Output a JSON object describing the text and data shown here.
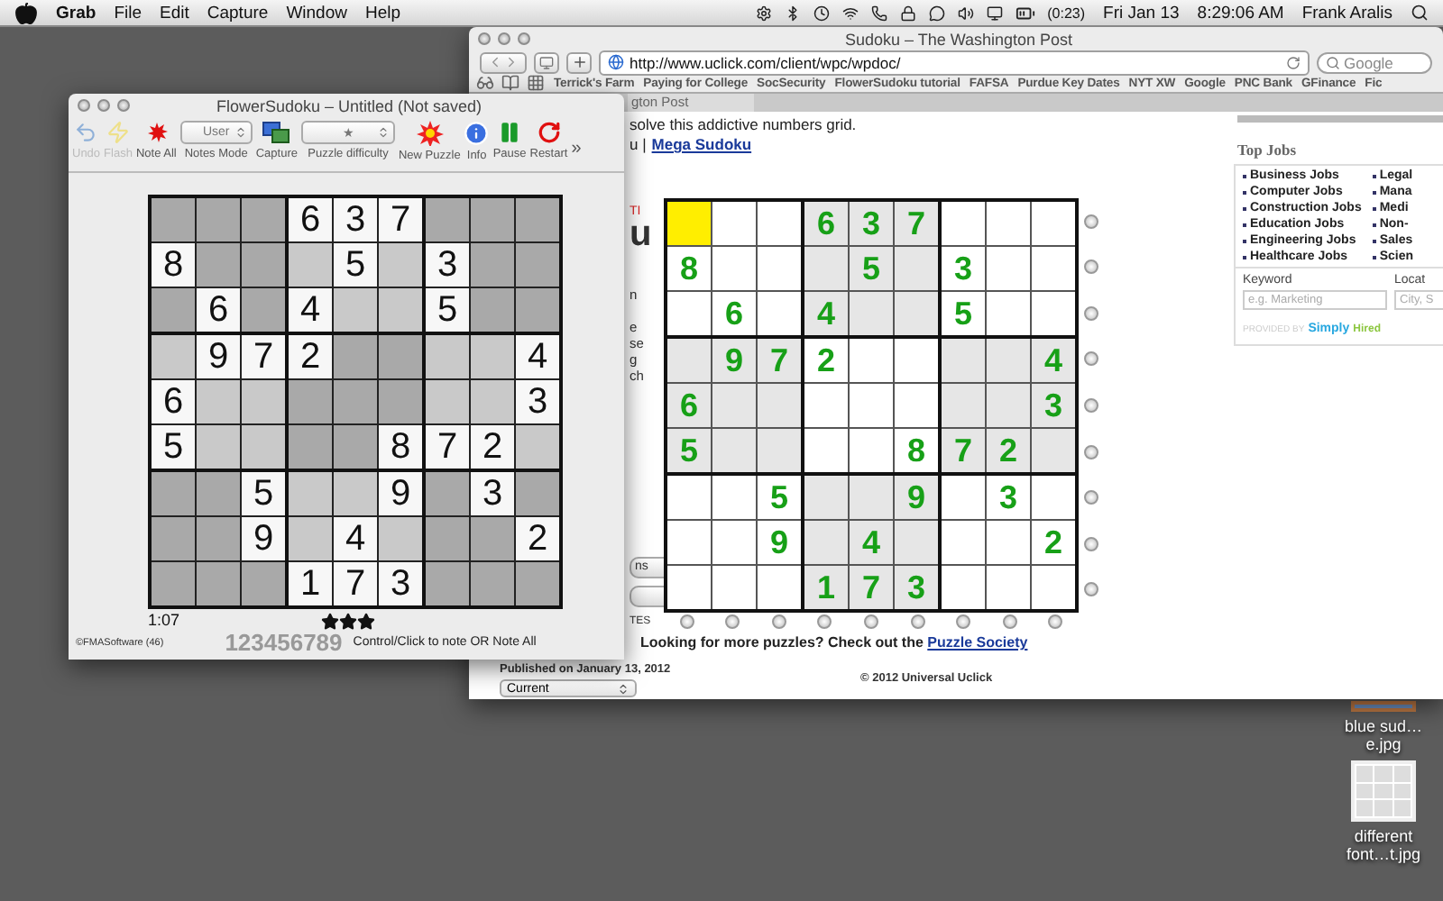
{
  "menu_bar": {
    "app": "Grab",
    "menus": [
      "File",
      "Edit",
      "Capture",
      "Window",
      "Help"
    ],
    "battery": "(0:23)",
    "date": "Fri Jan 13",
    "time": "8:29:06 AM",
    "user": "Frank Aralis"
  },
  "browser": {
    "title": "Sudoku – The Washington Post",
    "url": "http://www.uclick.com/client/wpc/wpdoc/",
    "search_placeholder": "Google",
    "bookmarks": [
      "Terrick's Farm",
      "Paying for College",
      "SocSecurity",
      "FlowerSudoku tutorial",
      "FAFSA",
      "Purdue Key Dates",
      "NYT XW",
      "Google",
      "PNC Bank",
      "GFinance",
      "Fic"
    ],
    "tab": "gton Post",
    "intro": "solve this addictive numbers grid.",
    "links_prefix": "u |",
    "link": "Mega Sudoku",
    "side_fragments": {
      "red": "TI",
      "big": "u",
      "lines": [
        "n",
        "e",
        "se",
        "g",
        "ch"
      ],
      "buttons": [
        "ns"
      ],
      "label": "TES"
    },
    "grid": {
      "rows": [
        [
          {
            "selected": true
          },
          {
            "selected": false
          },
          {
            "selected": false
          },
          {
            "value": "6",
            "selected": false
          },
          {
            "value": "3",
            "selected": false
          },
          {
            "value": "7",
            "selected": false
          },
          {
            "selected": false
          },
          {
            "selected": false
          },
          {
            "selected": false
          }
        ],
        [
          {
            "value": "8",
            "selected": false
          },
          {
            "selected": false
          },
          {
            "selected": false
          },
          {
            "selected": false
          },
          {
            "value": "5",
            "selected": false
          },
          {
            "selected": false
          },
          {
            "value": "3",
            "selected": false
          },
          {
            "selected": false
          },
          {
            "selected": false
          }
        ],
        [
          {
            "selected": false
          },
          {
            "value": "6",
            "selected": false
          },
          {
            "selected": false
          },
          {
            "value": "4",
            "selected": false
          },
          {
            "selected": false
          },
          {
            "selected": false
          },
          {
            "value": "5",
            "selected": false
          },
          {
            "selected": false
          },
          {
            "selected": false
          }
        ],
        [
          {
            "selected": false
          },
          {
            "value": "9",
            "selected": false
          },
          {
            "value": "7",
            "selected": false
          },
          {
            "value": "2",
            "selected": false
          },
          {
            "selected": false
          },
          {
            "selected": false
          },
          {
            "selected": false
          },
          {
            "selected": false
          },
          {
            "value": "4",
            "selected": false
          }
        ],
        [
          {
            "value": "6",
            "selected": false
          },
          {
            "selected": false
          },
          {
            "selected": false
          },
          {
            "selected": false
          },
          {
            "selected": false
          },
          {
            "selected": false
          },
          {
            "selected": false
          },
          {
            "selected": false
          },
          {
            "value": "3",
            "selected": false
          }
        ],
        [
          {
            "value": "5",
            "selected": false
          },
          {
            "selected": false
          },
          {
            "selected": false
          },
          {
            "selected": false
          },
          {
            "selected": false
          },
          {
            "value": "8",
            "selected": false
          },
          {
            "value": "7",
            "selected": false
          },
          {
            "value": "2",
            "selected": false
          },
          {
            "selected": false
          }
        ],
        [
          {
            "selected": false
          },
          {
            "selected": false
          },
          {
            "value": "5",
            "selected": false
          },
          {
            "selected": false
          },
          {
            "selected": false
          },
          {
            "value": "9",
            "selected": false
          },
          {
            "selected": false
          },
          {
            "value": "3",
            "selected": false
          },
          {
            "selected": false
          }
        ],
        [
          {
            "selected": false
          },
          {
            "selected": false
          },
          {
            "value": "9",
            "selected": false
          },
          {
            "selected": false
          },
          {
            "value": "4",
            "selected": false
          },
          {
            "selected": false
          },
          {
            "selected": false
          },
          {
            "selected": false
          },
          {
            "value": "2",
            "selected": false
          }
        ],
        [
          {
            "selected": false
          },
          {
            "selected": false
          },
          {
            "selected": false
          },
          {
            "value": "1",
            "selected": false
          },
          {
            "value": "7",
            "selected": false
          },
          {
            "value": "3",
            "selected": false
          },
          {
            "selected": false
          },
          {
            "selected": false
          },
          {
            "selected": false
          }
        ]
      ]
    },
    "row_radios": [
      {
        "checked": false
      },
      {
        "checked": false
      },
      {
        "checked": false
      },
      {
        "checked": false
      },
      {
        "checked": false
      },
      {
        "checked": false
      },
      {
        "checked": false
      },
      {
        "checked": false
      },
      {
        "checked": false
      }
    ],
    "column_radios": [
      {
        "checked": false
      },
      {
        "checked": false
      },
      {
        "checked": false
      },
      {
        "checked": false
      },
      {
        "checked": false
      },
      {
        "checked": false
      },
      {
        "checked": false
      },
      {
        "checked": false
      },
      {
        "checked": false
      }
    ],
    "more_text": "Looking for more puzzles? Check out the",
    "more_link": "Puzzle Society",
    "published": "Published on January 13, 2012",
    "select": "Current",
    "copyright": "© 2012 Universal Uclick",
    "jobs": {
      "title": "Top Jobs",
      "columns": [
        [
          "Business Jobs",
          "Computer Jobs",
          "Construction Jobs",
          "Education Jobs",
          "Engineering Jobs",
          "Healthcare Jobs"
        ],
        [
          "Legal",
          "Mana",
          "Medi",
          "Non-",
          "Sales",
          "Scien"
        ]
      ],
      "keyword_label": "Keyword",
      "keyword_placeholder": "e.g. Marketing",
      "location_label": "Locat",
      "location_placeholder": "City, S",
      "provided_by": "PROVIDED BY",
      "brand_a": "Simply",
      "brand_b": "Hired"
    }
  },
  "flower_sudoku": {
    "title": "FlowerSudoku – Untitled (Not saved)",
    "toolbar": [
      {
        "label": "Undo",
        "kind": "undo",
        "disabled": true
      },
      {
        "label": "Flash",
        "kind": "flash",
        "disabled": true
      },
      {
        "label": "Note All",
        "kind": "note_all",
        "disabled": false
      },
      {
        "label": "Notes Mode",
        "kind": "popup",
        "value": "User",
        "disabled": false
      },
      {
        "label": "Capture",
        "kind": "capture",
        "disabled": false
      },
      {
        "label": "Puzzle difficulty",
        "kind": "popup",
        "value": "★",
        "disabled": false
      },
      {
        "label": "New Puzzle",
        "kind": "new_puzzle",
        "disabled": false
      },
      {
        "label": "Info",
        "kind": "info",
        "disabled": false
      },
      {
        "label": "Pause",
        "kind": "pause",
        "disabled": false
      },
      {
        "label": "Restart",
        "kind": "restart",
        "disabled": false
      }
    ],
    "overflow": "»",
    "grid": [
      [
        {
          "filled": false
        },
        {
          "filled": false
        },
        {
          "filled": false
        },
        {
          "value": "6",
          "filled": true
        },
        {
          "value": "3",
          "filled": true
        },
        {
          "value": "7",
          "filled": true
        },
        {
          "filled": false
        },
        {
          "filled": false
        },
        {
          "filled": false
        }
      ],
      [
        {
          "value": "8",
          "filled": true
        },
        {
          "filled": false
        },
        {
          "filled": false
        },
        {
          "filled": false
        },
        {
          "value": "5",
          "filled": true
        },
        {
          "filled": false
        },
        {
          "value": "3",
          "filled": true
        },
        {
          "filled": false
        },
        {
          "filled": false
        }
      ],
      [
        {
          "filled": false
        },
        {
          "value": "6",
          "filled": true
        },
        {
          "filled": false
        },
        {
          "value": "4",
          "filled": true
        },
        {
          "filled": false
        },
        {
          "filled": false
        },
        {
          "value": "5",
          "filled": true
        },
        {
          "filled": false
        },
        {
          "filled": false
        }
      ],
      [
        {
          "filled": false
        },
        {
          "value": "9",
          "filled": true
        },
        {
          "value": "7",
          "filled": true
        },
        {
          "value": "2",
          "filled": true
        },
        {
          "filled": false
        },
        {
          "filled": false
        },
        {
          "filled": false
        },
        {
          "filled": false
        },
        {
          "value": "4",
          "filled": true
        }
      ],
      [
        {
          "value": "6",
          "filled": true
        },
        {
          "filled": false
        },
        {
          "filled": false
        },
        {
          "filled": false
        },
        {
          "filled": false
        },
        {
          "filled": false
        },
        {
          "filled": false
        },
        {
          "filled": false
        },
        {
          "value": "3",
          "filled": true
        }
      ],
      [
        {
          "value": "5",
          "filled": true
        },
        {
          "filled": false
        },
        {
          "filled": false
        },
        {
          "filled": false
        },
        {
          "filled": false
        },
        {
          "value": "8",
          "filled": true
        },
        {
          "value": "7",
          "filled": true
        },
        {
          "value": "2",
          "filled": true
        },
        {
          "filled": false
        }
      ],
      [
        {
          "filled": false
        },
        {
          "filled": false
        },
        {
          "value": "5",
          "filled": true
        },
        {
          "filled": false
        },
        {
          "filled": false
        },
        {
          "value": "9",
          "filled": true
        },
        {
          "filled": false
        },
        {
          "value": "3",
          "filled": true
        },
        {
          "filled": false
        }
      ],
      [
        {
          "filled": false
        },
        {
          "filled": false
        },
        {
          "value": "9",
          "filled": true
        },
        {
          "filled": false
        },
        {
          "value": "4",
          "filled": true
        },
        {
          "filled": false
        },
        {
          "filled": false
        },
        {
          "filled": false
        },
        {
          "value": "2",
          "filled": true
        }
      ],
      [
        {
          "filled": false
        },
        {
          "filled": false
        },
        {
          "filled": false
        },
        {
          "value": "1",
          "filled": true
        },
        {
          "value": "7",
          "filled": true
        },
        {
          "value": "3",
          "filled": true
        },
        {
          "filled": false
        },
        {
          "filled": false
        },
        {
          "filled": false
        }
      ]
    ],
    "timer": "1:07",
    "stars": 3,
    "copyright": "©FMASoftware (46)",
    "digits": "123456789",
    "hint": "Control/Click to note OR Note All"
  },
  "desktop_icons": [
    {
      "label": "blue sud…e.jpg",
      "kind": "photo"
    },
    {
      "label": "different font…t.jpg",
      "kind": "sudoku"
    }
  ]
}
